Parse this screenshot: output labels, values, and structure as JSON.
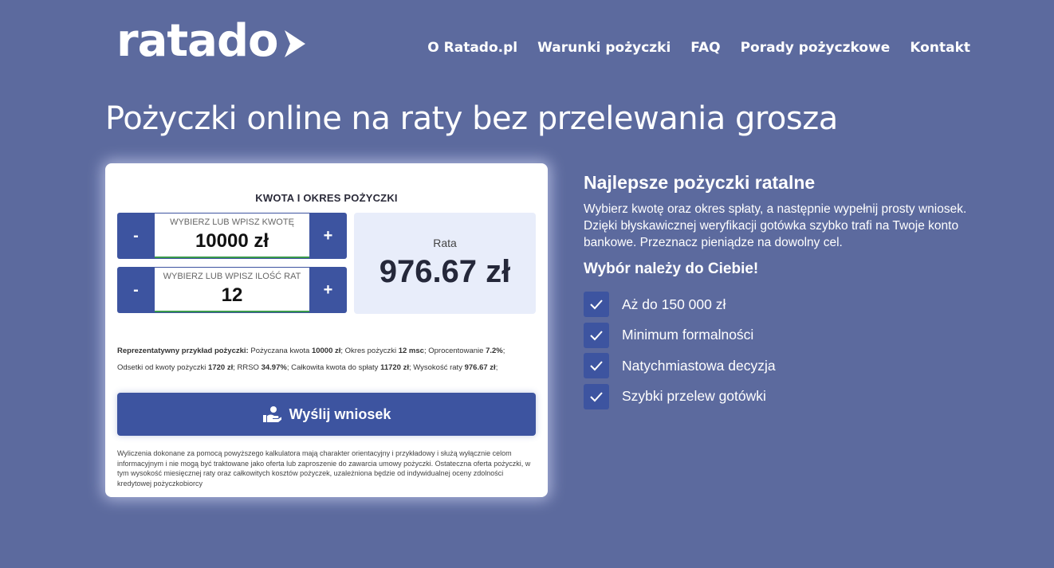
{
  "brand": {
    "logo_text": "ratado"
  },
  "nav": [
    "O Ratado.pl",
    "Warunki pożyczki",
    "FAQ",
    "Porady pożyczkowe",
    "Kontakt"
  ],
  "hero": {
    "title": "Pożyczki online na raty bez przelewania grosza"
  },
  "calculator": {
    "title": "KWOTA I OKRES POŻYCZKI",
    "amount": {
      "label": "WYBIERZ LUB WPISZ KWOTĘ",
      "value": "10000 zł",
      "minus": "-",
      "plus": "+"
    },
    "installments": {
      "label": "WYBIERZ LUB WPISZ ILOŚĆ RAT",
      "value": "12",
      "minus": "-",
      "plus": "+"
    },
    "rate": {
      "label": "Rata",
      "value": "976.67 zł"
    },
    "example": {
      "intro": "Reprezentatywny przykład pożyczki:",
      "t1": " Pożyczana kwota ",
      "v1": "10000 zł",
      "t2": "; Okres pożyczki ",
      "v2": "12 msc",
      "t3": "; Oprocentowanie ",
      "v3": "7.2%",
      "t4": ";",
      "t5": "Odsetki od kwoty pożyczki ",
      "v5": "1720 zł",
      "t6": "; RRSO ",
      "v6": "34.97%",
      "t7": "; Całkowita kwota do spłaty ",
      "v7": "11720 zł",
      "t8": "; Wysokość raty ",
      "v8": "976.67 zł",
      "t9": ";"
    },
    "submit_label": "Wyślij wniosek",
    "disclaimer": "Wyliczenia dokonane za pomocą powyższego kalkulatora mają charakter orientacyjny i przykładowy i służą wyłącznie celom informacyjnym i nie mogą być traktowane jako oferta lub zaproszenie do zawarcia umowy pożyczki. Ostateczna oferta pożyczki, w tym wysokość miesięcznej raty oraz całkowitych kosztów pożyczek, uzależniona będzie od indywidualnej oceny zdolności kredytowej pożyczkobiorcy"
  },
  "info": {
    "heading": "Najlepsze pożyczki ratalne",
    "description": "Wybierz kwotę oraz okres spłaty, a następnie wypełnij prosty wniosek. Dzięki błyskawicznej weryfikacji gotówka szybko trafi na Twoje konto bankowe. Przeznacz pieniądze na dowolny cel.",
    "subheading": "Wybór należy do Ciebie!",
    "features": [
      "Aż do 150 000 zł",
      "Minimum formalności",
      "Natychmiastowa decyzja",
      "Szybki przelew gotówki"
    ]
  },
  "colors": {
    "background": "#5c6a9e",
    "accent": "#3d54a0",
    "rate_box": "#e8edfa"
  }
}
